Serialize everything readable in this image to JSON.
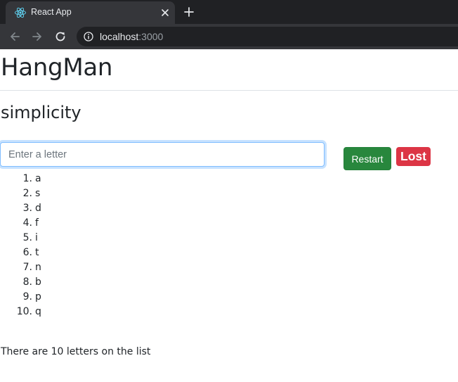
{
  "browser": {
    "tab_title": "React App",
    "url_host": "localhost",
    "url_port": ":3000"
  },
  "page": {
    "title": "HangMan",
    "word": "simplicity",
    "input_placeholder": "Enter a letter",
    "input_value": "",
    "restart_label": "Restart",
    "status_label": "Lost",
    "letters": [
      {
        "num": "1.",
        "letter": "a"
      },
      {
        "num": "2.",
        "letter": "s"
      },
      {
        "num": "3.",
        "letter": "d"
      },
      {
        "num": "4.",
        "letter": "f"
      },
      {
        "num": "5.",
        "letter": "i"
      },
      {
        "num": "6.",
        "letter": "t"
      },
      {
        "num": "7.",
        "letter": "n"
      },
      {
        "num": "8.",
        "letter": "b"
      },
      {
        "num": "9.",
        "letter": "p"
      },
      {
        "num": "10.",
        "letter": "q"
      }
    ],
    "footer_text": "There are 10 letters on the list"
  },
  "colors": {
    "restart_button": "#28873d",
    "lost_badge": "#dc3545",
    "browser_dark": "#202124"
  }
}
